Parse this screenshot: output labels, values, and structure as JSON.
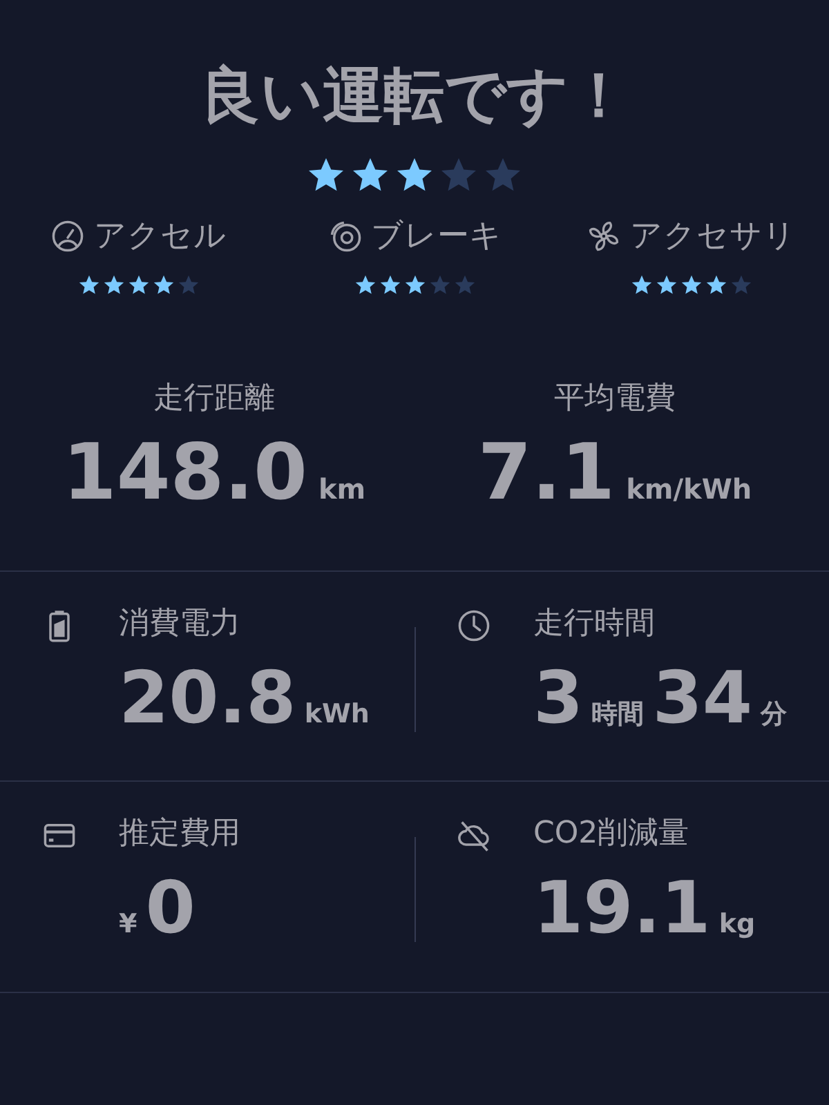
{
  "title": "良い運転です！",
  "overall": {
    "stars": 3
  },
  "categories": [
    {
      "kind": "accelerator",
      "label": "アクセル",
      "stars": 4
    },
    {
      "kind": "brake",
      "label": "ブレーキ",
      "stars": 3
    },
    {
      "kind": "accessory",
      "label": "アクセサリ",
      "stars": 4
    }
  ],
  "summary": [
    {
      "label": "走行距離",
      "parts": [
        {
          "kind": "number",
          "text": "148.0"
        },
        {
          "kind": "unit",
          "text": "km"
        }
      ]
    },
    {
      "label": "平均電費",
      "parts": [
        {
          "kind": "number",
          "text": "7.1"
        },
        {
          "kind": "unit",
          "text": "km/kWh"
        }
      ]
    }
  ],
  "details": [
    {
      "kind": "battery",
      "label": "消費電力",
      "parts": [
        {
          "kind": "number",
          "text": "20.8"
        },
        {
          "kind": "unit",
          "text": "kWh"
        }
      ]
    },
    {
      "kind": "clock",
      "label": "走行時間",
      "parts": [
        {
          "kind": "number",
          "text": "3"
        },
        {
          "kind": "unit",
          "text": "時間"
        },
        {
          "kind": "number",
          "text": "34"
        },
        {
          "kind": "unit",
          "text": "分"
        }
      ]
    },
    {
      "kind": "card",
      "label": "推定費用",
      "parts": [
        {
          "kind": "unit",
          "text": "¥"
        },
        {
          "kind": "number",
          "text": "0"
        }
      ]
    },
    {
      "kind": "cloud",
      "label": "CO2削減量",
      "parts": [
        {
          "kind": "number",
          "text": "19.1"
        },
        {
          "kind": "unit",
          "text": "kg"
        }
      ]
    }
  ]
}
